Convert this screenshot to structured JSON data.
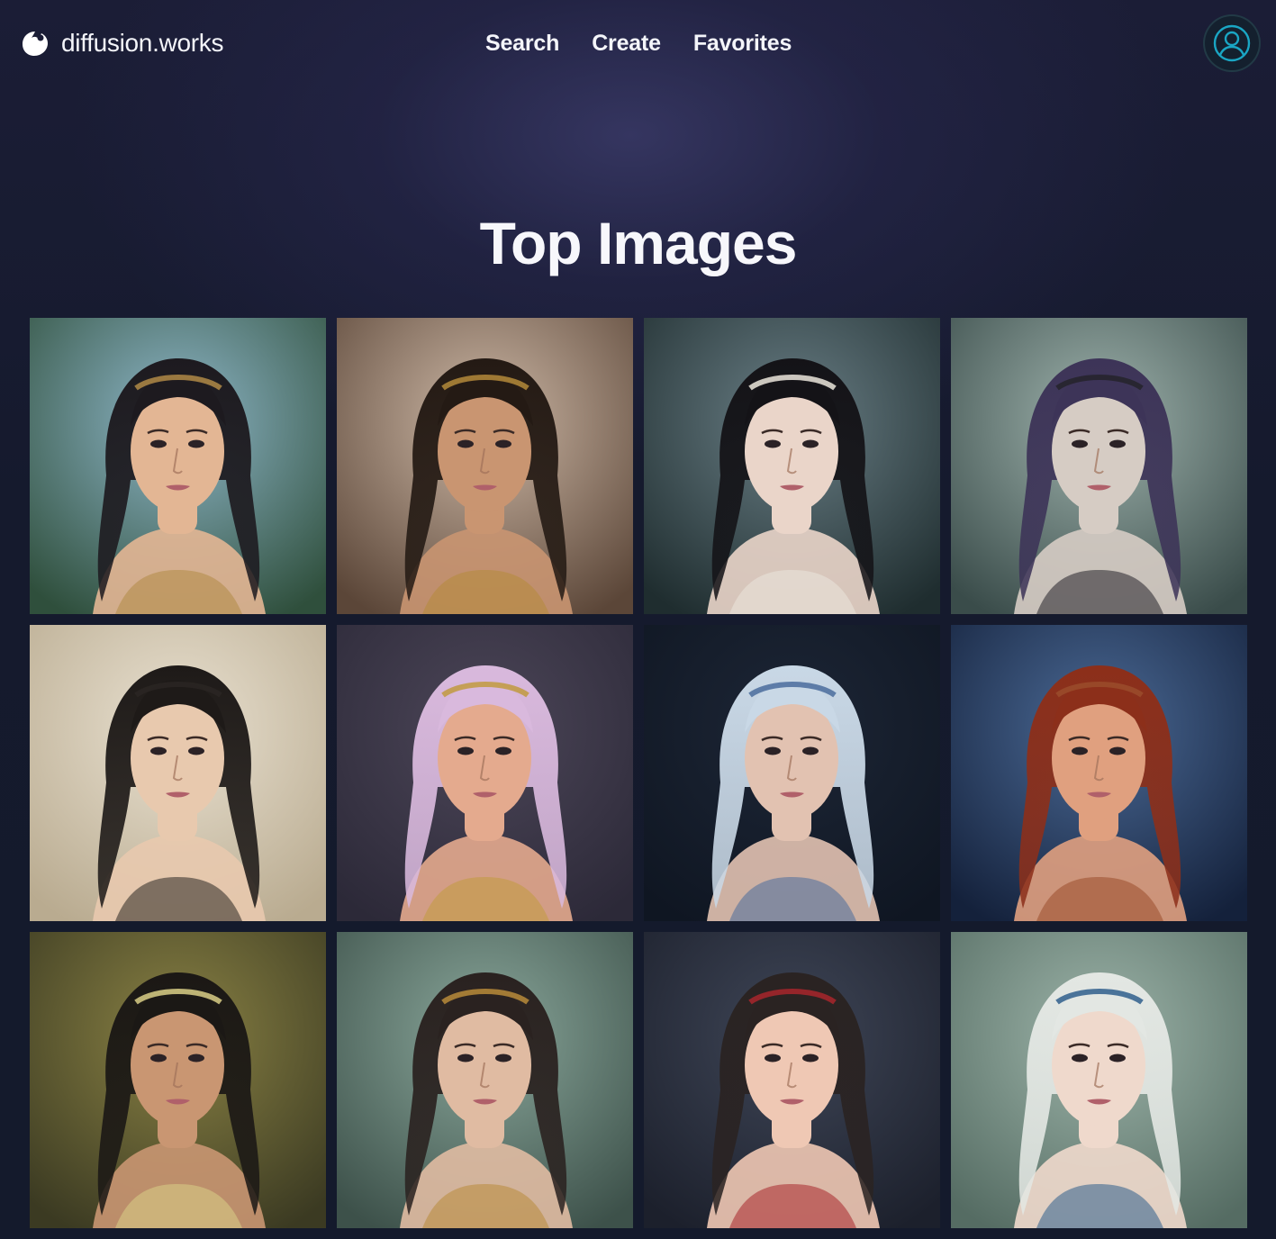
{
  "brand": {
    "name": "diffusion.works",
    "icon": "brand-logo-icon"
  },
  "nav": {
    "items": [
      {
        "label": "Search"
      },
      {
        "label": "Create"
      },
      {
        "label": "Favorites"
      }
    ]
  },
  "account": {
    "icon": "user-account-icon"
  },
  "main": {
    "title": "Top Images"
  },
  "gallery": {
    "images": [
      {
        "bg": [
          "#8fb7c9",
          "#2f4f3c"
        ],
        "hair": "#1d1a1f",
        "skin": "#e3b694",
        "accent": "#b08a46"
      },
      {
        "bg": [
          "#cdb8a6",
          "#5b4638"
        ],
        "hair": "#241a14",
        "skin": "#c99571",
        "accent": "#b48a3a"
      },
      {
        "bg": [
          "#6a7f86",
          "#1f2d2f"
        ],
        "hair": "#141317",
        "skin": "#ead5c9",
        "accent": "#ebe6dc"
      },
      {
        "bg": [
          "#9fb3ad",
          "#3a4c4a"
        ],
        "hair": "#3d3458",
        "skin": "#d6ccc4",
        "accent": "#24232a"
      },
      {
        "bg": [
          "#e9e1d1",
          "#b9ab90"
        ],
        "hair": "#1e1a18",
        "skin": "#e8c9ae",
        "accent": "#2a2623"
      },
      {
        "bg": [
          "#4c4658",
          "#2c2938"
        ],
        "hair": "#d9b9dd",
        "skin": "#e4aa8e",
        "accent": "#c19a3e"
      },
      {
        "bg": [
          "#1d2636",
          "#0f1622"
        ],
        "hair": "#c9d8e6",
        "skin": "#e2c2b1",
        "accent": "#4a6c9c"
      },
      {
        "bg": [
          "#4b6a96",
          "#14213b"
        ],
        "hair": "#8c2f1a",
        "skin": "#e0a07f",
        "accent": "#9a4c2b"
      },
      {
        "bg": [
          "#8a8244",
          "#3b3a22"
        ],
        "hair": "#1b1815",
        "skin": "#c99672",
        "accent": "#d9cf86"
      },
      {
        "bg": [
          "#8aa79b",
          "#3d514a"
        ],
        "hair": "#2a2220",
        "skin": "#e0bba2",
        "accent": "#b88b3a"
      },
      {
        "bg": [
          "#3f4657",
          "#1c202c"
        ],
        "hair": "#2a2322",
        "skin": "#efc8b4",
        "accent": "#a8262b"
      },
      {
        "bg": [
          "#9db4a9",
          "#556c63"
        ],
        "hair": "#e3e7e3",
        "skin": "#efd9cc",
        "accent": "#2f5e8c"
      }
    ]
  }
}
